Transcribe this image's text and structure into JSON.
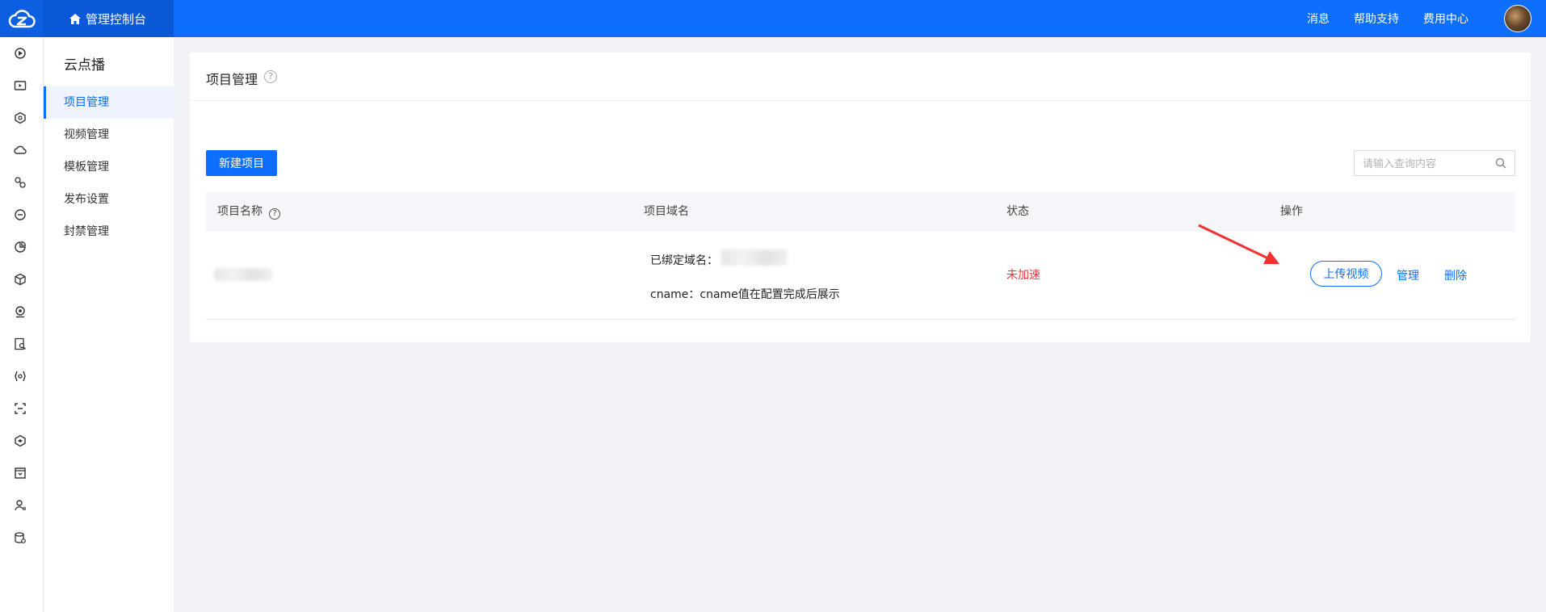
{
  "topbar": {
    "home_label": "管理控制台",
    "links": [
      "消息",
      "帮助支持",
      "费用中心"
    ]
  },
  "rail": {
    "icons": [
      "product-icon",
      "video-icon",
      "shield-icon",
      "cloud-icon",
      "network-icon",
      "refresh-icon",
      "chart-icon",
      "box-icon",
      "camera-icon",
      "document-search-icon",
      "bracket-icon",
      "scan-icon",
      "cube-icon",
      "storage-icon",
      "user-icon",
      "database-icon"
    ]
  },
  "submenu": {
    "title": "云点播",
    "items": [
      {
        "label": "项目管理",
        "active": true
      },
      {
        "label": "视频管理",
        "active": false
      },
      {
        "label": "模板管理",
        "active": false
      },
      {
        "label": "发布设置",
        "active": false
      },
      {
        "label": "封禁管理",
        "active": false
      }
    ]
  },
  "page": {
    "title": "项目管理",
    "help_glyph": "?"
  },
  "toolbar": {
    "new_label": "新建项目",
    "search_placeholder": "请输入查询内容"
  },
  "table": {
    "headers": {
      "name": "项目名称",
      "domain": "项目域名",
      "status": "状态",
      "action": "操作"
    },
    "rows": [
      {
        "bound_domain_label": "已绑定域名：",
        "cname_text": "cname：cname值在配置完成后展示",
        "status": "未加速",
        "actions": {
          "upload": "上传视频",
          "manage": "管理",
          "delete": "删除"
        }
      }
    ]
  },
  "colors": {
    "brand": "#0d6efd",
    "status_red": "#e5363a",
    "annotation_arrow": "#f03232"
  }
}
